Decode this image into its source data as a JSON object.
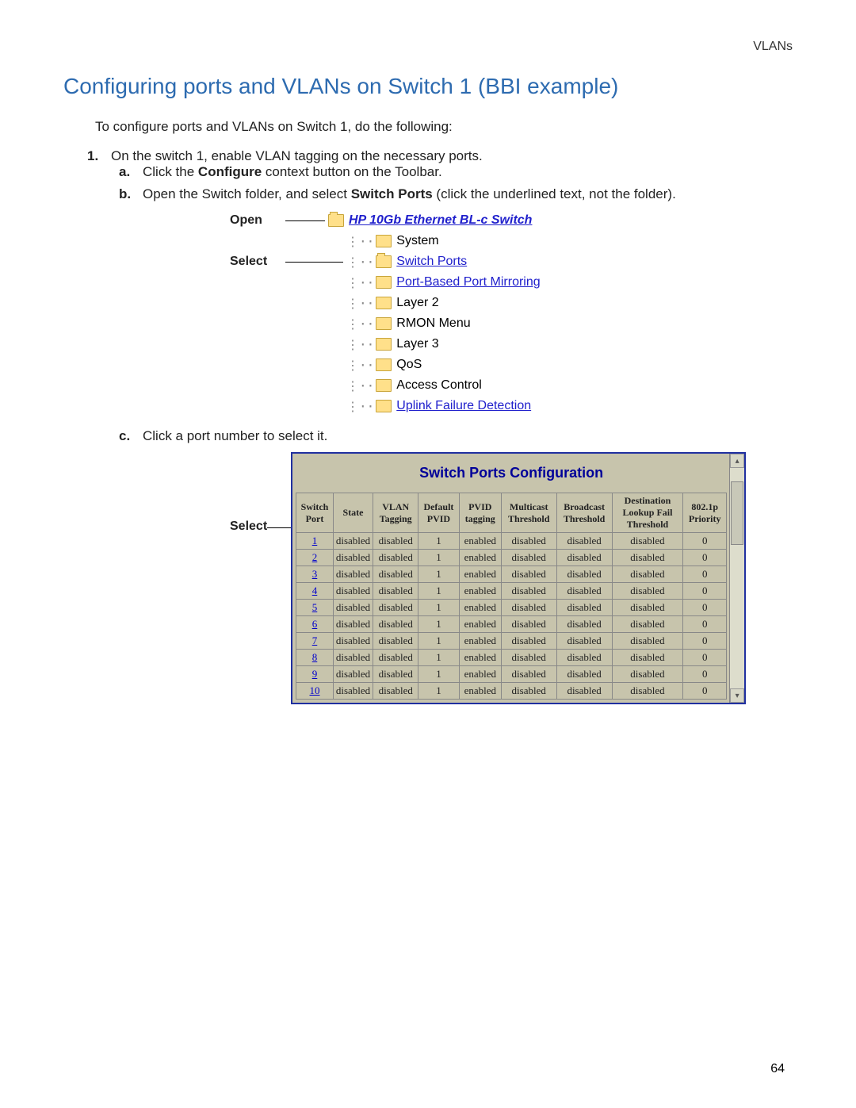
{
  "header": {
    "right": "VLANs"
  },
  "section": {
    "title": "Configuring ports and VLANs on Switch 1 (BBI example)"
  },
  "intro": "To configure ports and VLANs on Switch 1, do the following:",
  "step1": {
    "num": "1",
    "text": "On the switch 1, enable VLAN tagging on the necessary ports.",
    "a": {
      "letter": "a",
      "prefix": "Click the ",
      "bold": "Configure",
      "suffix": " context button on the Toolbar."
    },
    "b": {
      "letter": "b",
      "prefix": "Open the Switch folder, and select ",
      "bold": "Switch Ports",
      "suffix": " (click the underlined text, not the folder)."
    },
    "c": {
      "letter": "c",
      "text": "Click a port number to select it."
    }
  },
  "tree": {
    "openLabel": "Open",
    "selectLabel": "Select",
    "root": "HP 10Gb Ethernet BL-c Switch",
    "items": [
      {
        "text": "System",
        "link": false
      },
      {
        "text": "Switch Ports",
        "link": true,
        "selected": true
      },
      {
        "text": "Port-Based Port Mirroring",
        "link": true
      },
      {
        "text": "Layer 2",
        "link": false
      },
      {
        "text": "RMON Menu",
        "link": false
      },
      {
        "text": "Layer 3",
        "link": false
      },
      {
        "text": "QoS",
        "link": false
      },
      {
        "text": "Access Control",
        "link": false
      },
      {
        "text": "Uplink Failure Detection",
        "link": true
      }
    ]
  },
  "table": {
    "selectLabel": "Select",
    "title": "Switch Ports Configuration",
    "headers": [
      "Switch Port",
      "State",
      "VLAN Tagging",
      "Default PVID",
      "PVID tagging",
      "Multicast Threshold",
      "Broadcast Threshold",
      "Destination Lookup Fail Threshold",
      "802.1p Priority"
    ],
    "rows": [
      {
        "port": "1",
        "state": "disabled",
        "vlan": "disabled",
        "pvid": "1",
        "ptag": "enabled",
        "mcast": "disabled",
        "bcast": "disabled",
        "dlf": "disabled",
        "prio": "0"
      },
      {
        "port": "2",
        "state": "disabled",
        "vlan": "disabled",
        "pvid": "1",
        "ptag": "enabled",
        "mcast": "disabled",
        "bcast": "disabled",
        "dlf": "disabled",
        "prio": "0"
      },
      {
        "port": "3",
        "state": "disabled",
        "vlan": "disabled",
        "pvid": "1",
        "ptag": "enabled",
        "mcast": "disabled",
        "bcast": "disabled",
        "dlf": "disabled",
        "prio": "0"
      },
      {
        "port": "4",
        "state": "disabled",
        "vlan": "disabled",
        "pvid": "1",
        "ptag": "enabled",
        "mcast": "disabled",
        "bcast": "disabled",
        "dlf": "disabled",
        "prio": "0"
      },
      {
        "port": "5",
        "state": "disabled",
        "vlan": "disabled",
        "pvid": "1",
        "ptag": "enabled",
        "mcast": "disabled",
        "bcast": "disabled",
        "dlf": "disabled",
        "prio": "0"
      },
      {
        "port": "6",
        "state": "disabled",
        "vlan": "disabled",
        "pvid": "1",
        "ptag": "enabled",
        "mcast": "disabled",
        "bcast": "disabled",
        "dlf": "disabled",
        "prio": "0"
      },
      {
        "port": "7",
        "state": "disabled",
        "vlan": "disabled",
        "pvid": "1",
        "ptag": "enabled",
        "mcast": "disabled",
        "bcast": "disabled",
        "dlf": "disabled",
        "prio": "0"
      },
      {
        "port": "8",
        "state": "disabled",
        "vlan": "disabled",
        "pvid": "1",
        "ptag": "enabled",
        "mcast": "disabled",
        "bcast": "disabled",
        "dlf": "disabled",
        "prio": "0"
      },
      {
        "port": "9",
        "state": "disabled",
        "vlan": "disabled",
        "pvid": "1",
        "ptag": "enabled",
        "mcast": "disabled",
        "bcast": "disabled",
        "dlf": "disabled",
        "prio": "0"
      },
      {
        "port": "10",
        "state": "disabled",
        "vlan": "disabled",
        "pvid": "1",
        "ptag": "enabled",
        "mcast": "disabled",
        "bcast": "disabled",
        "dlf": "disabled",
        "prio": "0"
      }
    ]
  },
  "pageNumber": "64"
}
